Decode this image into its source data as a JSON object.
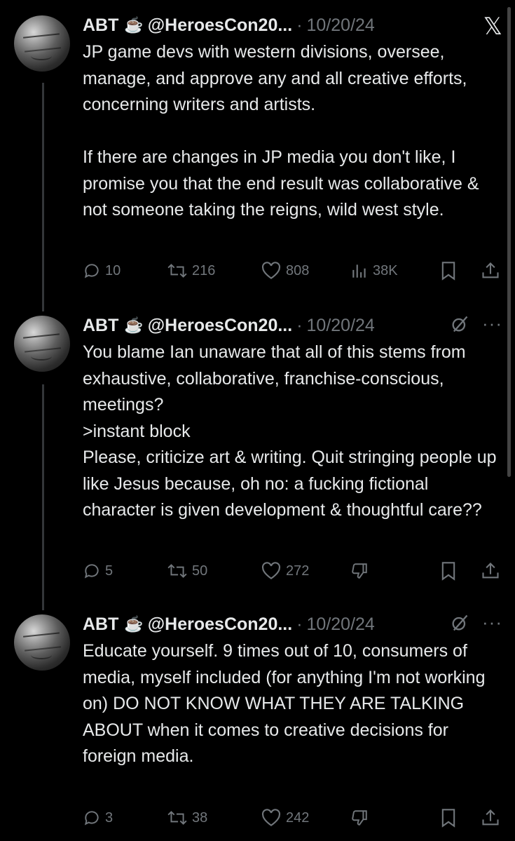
{
  "tweets": [
    {
      "author": "ABT",
      "emoji": "☕",
      "handle": "@HeroesCon20...",
      "date": "10/20/24",
      "text": "JP game devs with western divisions, oversee, manage, and approve any and all creative efforts, concerning writers and artists.\n\nIf there are changes in JP media you don't like, I promise you that the end result was collaborative & not someone taking the reigns, wild west style.",
      "replies": "10",
      "reposts": "216",
      "likes": "808",
      "views": "38K",
      "corner_icon": "x-logo-icon"
    },
    {
      "author": "ABT",
      "emoji": "☕",
      "handle": "@HeroesCon20...",
      "date": "10/20/24",
      "text": "You blame Ian unaware that all of this stems from exhaustive, collaborative, franchise-conscious, meetings?\n>instant block\nPlease, criticize art & writing. Quit stringing people up like Jesus because, oh no: a fucking fictional character is given development & thoughtful care??",
      "replies": "5",
      "reposts": "50",
      "likes": "272",
      "corner_icon": "grok-icon"
    },
    {
      "author": "ABT",
      "emoji": "☕",
      "handle": "@HeroesCon20...",
      "date": "10/20/24",
      "text": "Educate yourself. 9 times out of 10, consumers of media, myself included (for anything I'm not working on) DO NOT KNOW WHAT THEY ARE TALKING ABOUT when it comes to creative decisions for foreign media.",
      "replies": "3",
      "reposts": "38",
      "likes": "242",
      "corner_icon": "grok-icon"
    }
  ],
  "colors": {
    "background": "#000000",
    "text": "#e7e9ea",
    "muted": "#71767b",
    "thread_line": "#333639"
  }
}
